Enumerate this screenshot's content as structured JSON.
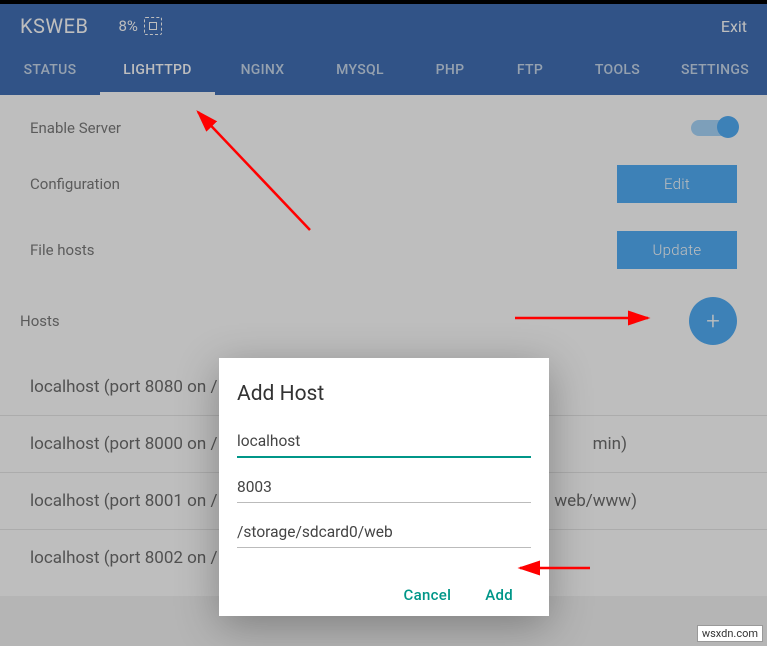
{
  "header": {
    "title": "KSWEB",
    "cpu_percent": "8%",
    "exit_label": "Exit"
  },
  "tabs": [
    {
      "id": "status",
      "label": "STATUS"
    },
    {
      "id": "lighttpd",
      "label": "LIGHTTPD"
    },
    {
      "id": "nginx",
      "label": "NGINX"
    },
    {
      "id": "mysql",
      "label": "MYSQL"
    },
    {
      "id": "php",
      "label": "PHP"
    },
    {
      "id": "ftp",
      "label": "FTP"
    },
    {
      "id": "tools",
      "label": "TOOLS"
    },
    {
      "id": "settings",
      "label": "SETTINGS"
    }
  ],
  "rows": {
    "enable_server": "Enable Server",
    "configuration": "Configuration",
    "edit_btn": "Edit",
    "file_hosts": "File hosts",
    "update_btn": "Update",
    "hosts": "Hosts",
    "fab": "+"
  },
  "host_items": [
    "localhost (port 8080 on /",
    "localhost (port 8000 on /",
    "localhost (port 8001 on /",
    "localhost (port 8002 on /"
  ],
  "host_item_suffix": [
    "",
    "min)",
    "web/www)",
    ""
  ],
  "dialog": {
    "title": "Add Host",
    "host_value": "localhost",
    "port_value": "8003",
    "path_value": "/storage/sdcard0/web",
    "cancel": "Cancel",
    "add": "Add"
  },
  "watermark": "wsxdn.com"
}
